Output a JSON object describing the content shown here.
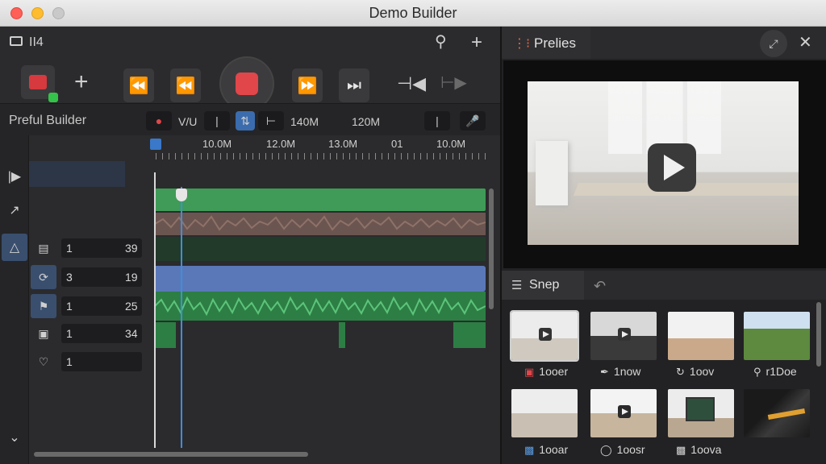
{
  "window": {
    "title": "Demo Builder"
  },
  "toolbar": {
    "project_icon_label": "II4"
  },
  "timeline": {
    "project_name": "Preful Builder",
    "header_buttons": {
      "vu_label": "V/U"
    },
    "readouts": [
      "140M",
      "120M"
    ],
    "ruler_labels": [
      "10.0M",
      "12.0M",
      "13.0M",
      "01",
      "10.0M"
    ]
  },
  "tracks": [
    {
      "a": "1",
      "b": "39",
      "icon": "list-icon"
    },
    {
      "a": "3",
      "b": "19",
      "icon": "loop-icon"
    },
    {
      "a": "1",
      "b": "25",
      "icon": "bookmark-icon"
    },
    {
      "a": "1",
      "b": "34",
      "icon": "subtitle-icon"
    },
    {
      "a": "1",
      "b": "",
      "icon": "heart-icon"
    }
  ],
  "preview": {
    "tab_label": "Prelies"
  },
  "snippets": {
    "tab_label": "Snep",
    "items": [
      {
        "label": "1ooer"
      },
      {
        "label": "1now"
      },
      {
        "label": "1oov"
      },
      {
        "label": "r1Doe"
      },
      {
        "label": "1ooar"
      },
      {
        "label": "1oosr"
      },
      {
        "label": "1oova"
      },
      {
        "label": ""
      }
    ]
  },
  "colors": {
    "accent": "#3b6cae",
    "record": "#e0464a",
    "clip_green": "#3f9b57",
    "clip_blue": "#5a78b8"
  }
}
